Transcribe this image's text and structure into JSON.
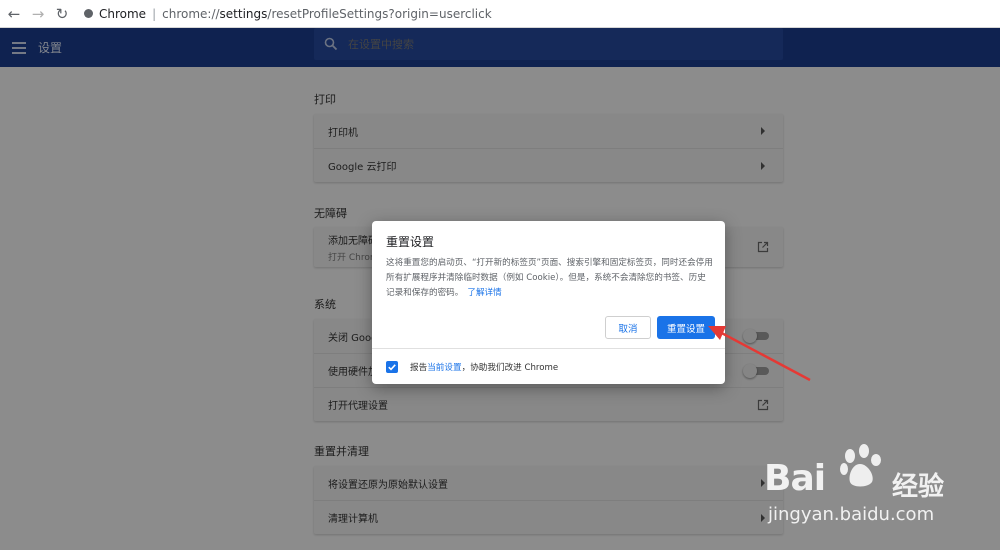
{
  "browser": {
    "url_host": "Chrome",
    "url_scheme": "chrome://",
    "url_bold": "settings",
    "url_rest": "/resetProfileSettings?origin=userclick"
  },
  "header": {
    "title": "设置",
    "search_placeholder": "在设置中搜索",
    "color": "#1a3c8a"
  },
  "sections": {
    "print": {
      "title": "打印",
      "items": [
        "打印机",
        "Google 云打印"
      ]
    },
    "accessibility": {
      "title": "无障碍",
      "item_label": "添加无障碍",
      "item_sub": "打开 Chrom"
    },
    "system": {
      "title": "系统",
      "items": [
        "关闭 Google",
        "使用硬件加",
        "打开代理设置"
      ]
    },
    "reset": {
      "title": "重置并清理",
      "items": [
        "将设置还原为原始默认设置",
        "清理计算机"
      ]
    }
  },
  "dialog": {
    "title": "重置设置",
    "body": "这将重置您的启动页、“打开新的标签页”页面、搜索引擎和固定标签页，同时还会停用所有扩展程序并清除临时数据（例如 Cookie）。但是，系统不会清除您的书签、历史记录和保存的密码。",
    "learn_more": "了解详情",
    "cancel_label": "取消",
    "reset_label": "重置设置",
    "report_prefix": "报告",
    "report_link": "当前设置",
    "report_suffix": "，协助我们改进 Chrome",
    "report_checked": true,
    "accent": "#1a73e8"
  },
  "watermark": {
    "brand": "Bai",
    "brand_cn": "经验",
    "url": "jingyan.baidu.com"
  }
}
